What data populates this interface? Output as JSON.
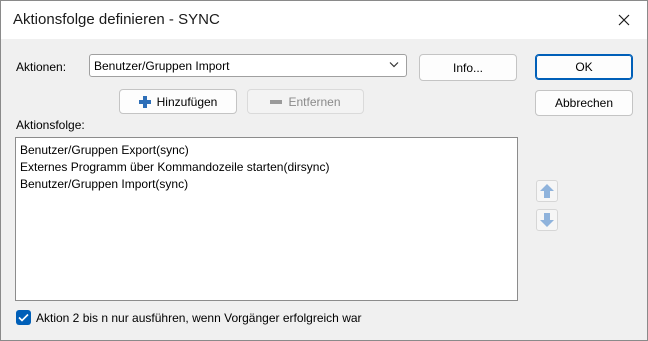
{
  "window": {
    "title": "Aktionsfolge definieren - SYNC"
  },
  "actions": {
    "label": "Aktionen:",
    "selected": "Benutzer/Gruppen Import",
    "info_button": "Info...",
    "add_button": "Hinzufügen",
    "remove_button": "Entfernen"
  },
  "dialog_buttons": {
    "ok": "OK",
    "cancel": "Abbrechen"
  },
  "sequence": {
    "label": "Aktionsfolge:",
    "items": [
      "Benutzer/Gruppen Export(sync)",
      "Externes Programm über Kommandozeile starten(dirsync)",
      "Benutzer/Gruppen Import(sync)"
    ]
  },
  "option": {
    "checked": true,
    "label": "Aktion 2 bis n nur ausführen, wenn Vorgänger erfolgreich war"
  },
  "colors": {
    "accent": "#005fb8",
    "arrow_icon": "#8fb3dc",
    "add_icon": "#2e6fb8"
  }
}
